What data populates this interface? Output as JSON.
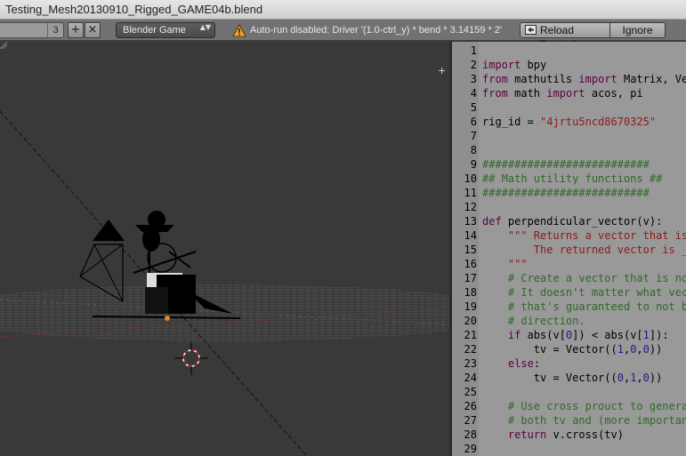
{
  "window": {
    "title": "Testing_Mesh20130910_Rigged_GAME04b.blend"
  },
  "header": {
    "scene_users": "3",
    "add_symbol": "+",
    "close_symbol": "×",
    "render_engine": "Blender Game",
    "engine_arrows": "▲▼",
    "warning": "Auto-run disabled: Driver '(1.0-ctrl_y) * bend * 3.14159 * 2'",
    "reload_label": "Reload Trusted",
    "ignore_label": "Ignore"
  },
  "viewport": {
    "corner_symbol": "+"
  },
  "editor": {
    "lines": [
      {
        "n": "1",
        "segs": []
      },
      {
        "n": "2",
        "segs": [
          {
            "t": "import",
            "c": "kw"
          },
          {
            "t": " bpy",
            "c": ""
          }
        ]
      },
      {
        "n": "3",
        "segs": [
          {
            "t": "from",
            "c": "kw"
          },
          {
            "t": " mathutils ",
            "c": ""
          },
          {
            "t": "import",
            "c": "kw"
          },
          {
            "t": " Matrix, Vec",
            "c": ""
          }
        ]
      },
      {
        "n": "4",
        "segs": [
          {
            "t": "from",
            "c": "kw"
          },
          {
            "t": " math ",
            "c": ""
          },
          {
            "t": "import",
            "c": "kw"
          },
          {
            "t": " acos, pi",
            "c": ""
          }
        ]
      },
      {
        "n": "5",
        "segs": []
      },
      {
        "n": "6",
        "segs": [
          {
            "t": "rig_id = ",
            "c": ""
          },
          {
            "t": "\"4jrtu5ncd8670325\"",
            "c": "str"
          }
        ]
      },
      {
        "n": "7",
        "segs": []
      },
      {
        "n": "8",
        "segs": []
      },
      {
        "n": "9",
        "segs": [
          {
            "t": "##########################",
            "c": "com"
          }
        ]
      },
      {
        "n": "10",
        "segs": [
          {
            "t": "## Math utility functions ##",
            "c": "com"
          }
        ]
      },
      {
        "n": "11",
        "segs": [
          {
            "t": "##########################",
            "c": "com"
          }
        ]
      },
      {
        "n": "12",
        "segs": []
      },
      {
        "n": "13",
        "segs": [
          {
            "t": "def",
            "c": "kw"
          },
          {
            "t": " perpendicular_vector(v):",
            "c": ""
          }
        ]
      },
      {
        "n": "14",
        "segs": [
          {
            "t": "    \"\"\" Returns a vector that is",
            "c": "str"
          }
        ]
      },
      {
        "n": "15",
        "segs": [
          {
            "t": "        The returned vector is _r",
            "c": "str"
          }
        ]
      },
      {
        "n": "16",
        "segs": [
          {
            "t": "    \"\"\"",
            "c": "str"
          }
        ]
      },
      {
        "n": "17",
        "segs": [
          {
            "t": "    # Create a vector that is not",
            "c": "com"
          }
        ]
      },
      {
        "n": "18",
        "segs": [
          {
            "t": "    # It doesn't matter what vect",
            "c": "com"
          }
        ]
      },
      {
        "n": "19",
        "segs": [
          {
            "t": "    # that's guaranteed to not be",
            "c": "com"
          }
        ]
      },
      {
        "n": "20",
        "segs": [
          {
            "t": "    # direction.",
            "c": "com"
          }
        ]
      },
      {
        "n": "21",
        "segs": [
          {
            "t": "    ",
            "c": ""
          },
          {
            "t": "if",
            "c": "kw"
          },
          {
            "t": " abs(v[",
            "c": ""
          },
          {
            "t": "0",
            "c": "num"
          },
          {
            "t": "]) < abs(v[",
            "c": ""
          },
          {
            "t": "1",
            "c": "num"
          },
          {
            "t": "]):",
            "c": ""
          }
        ]
      },
      {
        "n": "22",
        "segs": [
          {
            "t": "        tv = Vector((",
            "c": ""
          },
          {
            "t": "1",
            "c": "num"
          },
          {
            "t": ",",
            "c": ""
          },
          {
            "t": "0",
            "c": "num"
          },
          {
            "t": ",",
            "c": ""
          },
          {
            "t": "0",
            "c": "num"
          },
          {
            "t": "))",
            "c": ""
          }
        ]
      },
      {
        "n": "23",
        "segs": [
          {
            "t": "    ",
            "c": ""
          },
          {
            "t": "else",
            "c": "kw"
          },
          {
            "t": ":",
            "c": ""
          }
        ]
      },
      {
        "n": "24",
        "segs": [
          {
            "t": "        tv = Vector((",
            "c": ""
          },
          {
            "t": "0",
            "c": "num"
          },
          {
            "t": ",",
            "c": ""
          },
          {
            "t": "1",
            "c": "num"
          },
          {
            "t": ",",
            "c": ""
          },
          {
            "t": "0",
            "c": "num"
          },
          {
            "t": "))",
            "c": ""
          }
        ]
      },
      {
        "n": "25",
        "segs": []
      },
      {
        "n": "26",
        "segs": [
          {
            "t": "    # Use cross prouct to generat",
            "c": "com"
          }
        ]
      },
      {
        "n": "27",
        "segs": [
          {
            "t": "    # both tv and (more important",
            "c": "com"
          }
        ]
      },
      {
        "n": "28",
        "segs": [
          {
            "t": "    ",
            "c": ""
          },
          {
            "t": "return",
            "c": "kw"
          },
          {
            "t": " v.cross(tv)",
            "c": ""
          }
        ]
      },
      {
        "n": "29",
        "segs": []
      }
    ]
  }
}
